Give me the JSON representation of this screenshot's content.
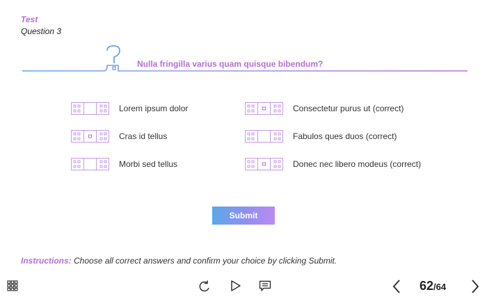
{
  "header": {
    "title": "Test",
    "subtitle": "Question 3"
  },
  "question": {
    "text": "Nulla fringilla varius quam quisque bibendum?"
  },
  "options": [
    {
      "label": "Lorem ipsum dolor",
      "marked": false
    },
    {
      "label": "Cras id tellus",
      "marked": true
    },
    {
      "label": "Morbi sed tellus",
      "marked": false
    },
    {
      "label": "Consectetur purus ut (correct)",
      "marked": true
    },
    {
      "label": "Fabulos ques duos (correct)",
      "marked": false
    },
    {
      "label": "Donec nec libero modeus (correct)",
      "marked": true
    }
  ],
  "submit": {
    "label": "Submit"
  },
  "instructions": {
    "lead": "Instructions:",
    "text": " Choose all correct answers and confirm your choice by clicking Submit."
  },
  "navigation": {
    "current_page": "62",
    "total_pages": "/64"
  },
  "icons": {
    "menu": "grid-menu-icon",
    "reload": "reload-icon",
    "play": "play-icon",
    "notes": "notes-icon",
    "prev": "chevron-left-icon",
    "next": "chevron-right-icon"
  },
  "colors": {
    "accent": "#b46fd6",
    "line": "#5aa9e6",
    "icon_outline": "#c39be8"
  }
}
